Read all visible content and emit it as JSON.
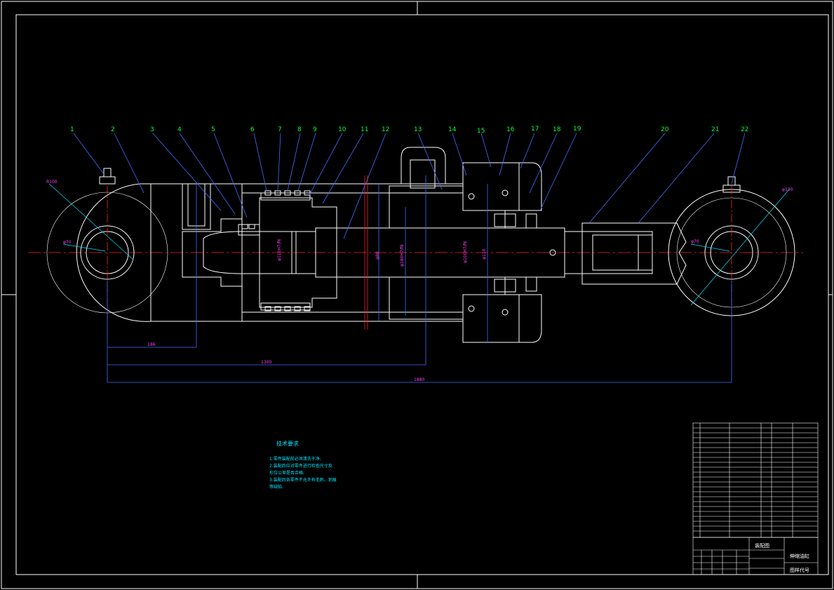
{
  "drawing": {
    "callouts": [
      "1",
      "2",
      "3",
      "4",
      "5",
      "6",
      "7",
      "8",
      "9",
      "10",
      "11",
      "12",
      "13",
      "14",
      "15",
      "16",
      "17",
      "18",
      "19",
      "20",
      "21",
      "22"
    ],
    "dimensions": {
      "d1": "186",
      "d2": "1300",
      "d3": "1880",
      "r_left": "R100",
      "phi_left": "φ70",
      "r_right": "φ130",
      "phi_right": "φ70"
    },
    "section_labels": [
      "φ110H7/f6",
      "φ180H7/f8",
      "φ100H7/f6",
      "φ80",
      "φ110"
    ],
    "notes": {
      "heading": "技术要求",
      "lines": [
        "1.零件装配前必须清洗干净;",
        "2.装配后应对零件进行检查尺寸及",
        "形位公差是否合格;",
        "3.装配后各零件不允许有毛刺、划痕",
        "等缺陷."
      ]
    },
    "title_block": {
      "drawing_type": "装配图",
      "part_name": "伸缩油缸",
      "drawing_code_label": "图样代号"
    }
  }
}
